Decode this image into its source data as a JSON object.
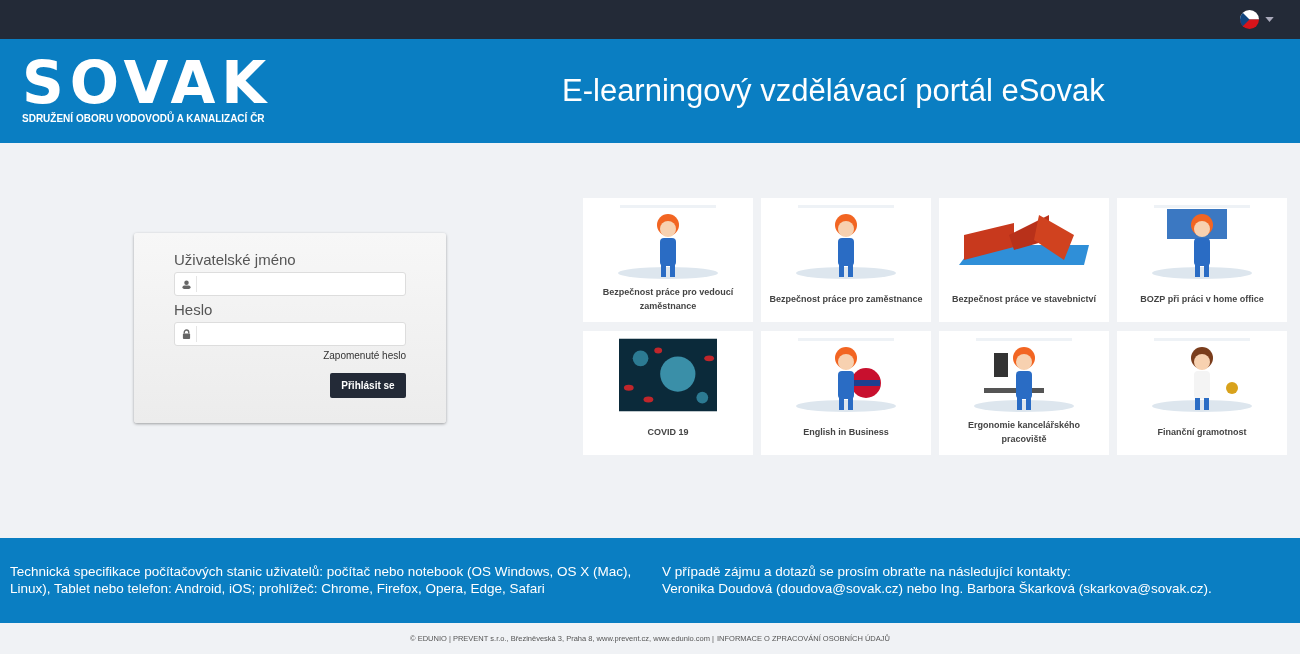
{
  "header": {
    "logo": "SOVAK",
    "logo_subtitle": "SDRUŽENÍ OBORU VODOVODŮ A KANALIZACÍ ČR",
    "title": "E-learningový vzdělávací portál eSovak"
  },
  "login": {
    "username_label": "Uživatelské jméno",
    "password_label": "Heslo",
    "forgot_link": "Zapomenuté heslo",
    "submit": "Přihlásit se"
  },
  "courses": [
    {
      "title": "Bezpečnost práce pro vedoucí zaměstnance",
      "kind": "picture"
    },
    {
      "title": "Bezpečnost práce pro zaměstnance",
      "kind": "picture"
    },
    {
      "title": "Bezpečnost práce ve stavebnictví",
      "kind": "picture"
    },
    {
      "title": "BOZP při práci v home office",
      "kind": "picture"
    },
    {
      "title": "COVID 19",
      "kind": "picture"
    },
    {
      "title": "English in Business",
      "kind": "picture"
    },
    {
      "title": "Ergonomie kancelářského pracoviště",
      "kind": "picture"
    },
    {
      "title": "Finanční gramotnost",
      "kind": "picture"
    }
  ],
  "footer": {
    "left": "Technická specifikace počítačových stanic uživatelů: počítač nebo notebook (OS Windows, OS X (Mac), Linux), Tablet nebo telefon: Android, iOS; prohlížeč: Chrome, Firefox, Opera, Edge, Safari",
    "right_line_1": "V případě zájmu a dotazů se prosím obraťte na následující kontakty:",
    "right_line_2": "Veronika Doudová (doudova@sovak.cz) nebo Ing. Barbora Škarková (skarkova@sovak.cz)."
  },
  "copyright": {
    "text": "© EDUNIO | PREVENT s.r.o., Březiněveská 3, Praha 8, www.prevent.cz, www.edunio.com |",
    "link": "INFORMACE O ZPRACOVÁNÍ OSOBNÍCH ÚDAJŮ"
  }
}
